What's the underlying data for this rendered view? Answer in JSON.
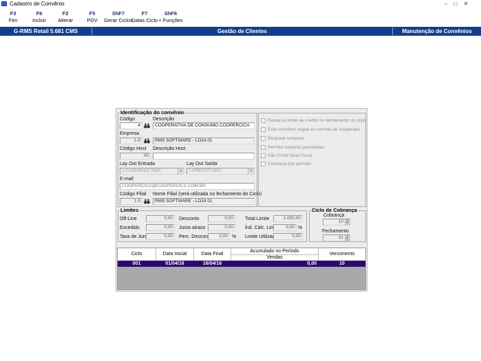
{
  "window": {
    "title": "Cadastro de Convênio"
  },
  "toolbar": [
    {
      "key": "F3",
      "label": "Fim"
    },
    {
      "key": "F6",
      "label": "Incluir"
    },
    {
      "key": "F2",
      "label": "Alterar"
    },
    {
      "key": "F5",
      "label": "PDV"
    },
    {
      "key": "ShF7",
      "label": "Gerar Ciclos"
    },
    {
      "key": "F7",
      "label": "Datas Ciclo"
    },
    {
      "key": "ShF6",
      "label": "+ Funções"
    }
  ],
  "header": {
    "left": "G-RMS Retail 5.681 CMS",
    "center": "Gestão de Clientes",
    "right": "Manutenção de Convênios"
  },
  "identificacao": {
    "title": "Identificação do convênio",
    "codigo_label": "Código",
    "codigo_value": "4",
    "descricao_label": "Descrição",
    "descricao_value": "COOPERATIVA DE CONSUMO COOPERCICA",
    "empresa_label": "Empresa",
    "empresa_value": "1-9",
    "empresa_desc": "RMS SOFTWARE - LOJA 01",
    "codigo_host_label": "Código Host",
    "codigo_host_value": "00",
    "descricao_host_label": "Descrição Host",
    "descricao_host_value": "",
    "layout_entrada_label": "Lay Out Entrada",
    "layout_entrada_value": "1-CONVENIO RMS",
    "layout_saida_label": "Lay Out Saída",
    "layout_saida_value": "7-PREFEITURA",
    "email_label": "E-mail",
    "email_value": "COOPERCICA@COOPERCICA.COM.BR",
    "codigo_filial_label": "Código Filial",
    "codigo_filial_value": "1-9",
    "nome_filial_label": "Nome Filial (será utilizada no fechamento do Ciclo)",
    "nome_filial_value": "RMS SOFTWARE - LOJA 01"
  },
  "options": [
    "Restaura limite de crédito no fechamento do ciclo",
    "Este convênio segue as normas de cooperado",
    "Bloquear compras",
    "Permite compras parceladas",
    "Não Emitir Nota Fiscal",
    "Cobrança por período"
  ],
  "limites": {
    "title": "Limites",
    "offline_label": "Off-Line",
    "offline_value": "0,00",
    "excedido_label": "Excedido",
    "excedido_value": "0,00",
    "taxa_juros_label": "Taxa de Juros",
    "taxa_juros_value": "0,00",
    "desconto_label": "Desconto",
    "desconto_value": "0,00",
    "juros_atraso_label": "Juros atraso",
    "juros_atraso_value": "0,00",
    "perc_desconto_label": "Perc. Desconto",
    "perc_desconto_value": "0,00",
    "perc_symbol": "%",
    "total_limite_label": "Total Limite",
    "total_limite_value": "1.000,00",
    "ind_calc_label": "Índ. Cálc. Lim",
    "ind_calc_value": "0,00",
    "limite_utilizado_label": "Limite Utilizado",
    "limite_utilizado_value": "0,00"
  },
  "ciclo_cobranca": {
    "title": "Ciclo de Cobrança",
    "cobranca_label": "Cobrança",
    "cobranca_value": "10",
    "fechamento_label": "Fechamento",
    "fechamento_value": "31"
  },
  "table": {
    "headers": {
      "ciclo": "Ciclo",
      "data_inicial": "Data Inicial",
      "data_final": "Data Final",
      "acumulado": "Acumulado no Período",
      "vendas": "Vendas",
      "vencimento": "Vencimento"
    },
    "rows": [
      {
        "ciclo": "001",
        "data_inicial": "01/04/16",
        "data_final": "16/04/16",
        "vendas": "0,00",
        "vencimento": "10"
      }
    ],
    "row_color": "#2b0a6e"
  }
}
